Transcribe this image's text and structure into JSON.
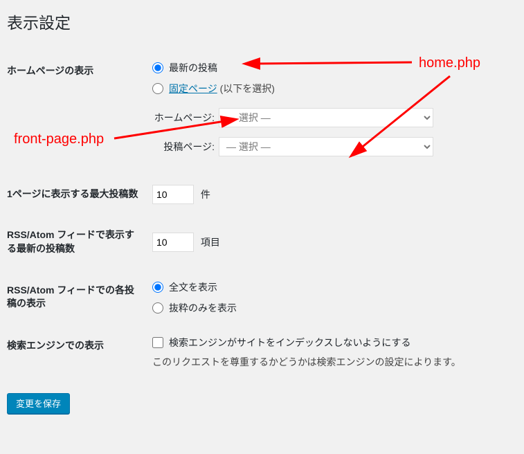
{
  "page_title": "表示設定",
  "homepage": {
    "label": "ホームページの表示",
    "opt_latest": "最新の投稿",
    "opt_static_link": "固定ページ",
    "opt_static_suffix": "(以下を選択)",
    "homepage_select_label": "ホームページ:",
    "posts_select_label": "投稿ページ:",
    "select_placeholder": "— 選択 —"
  },
  "posts_per_page": {
    "label": "1ページに表示する最大投稿数",
    "value": "10",
    "unit": "件"
  },
  "rss_posts": {
    "label": "RSS/Atom フィードで表示する最新の投稿数",
    "value": "10",
    "unit": "項目"
  },
  "rss_display": {
    "label": "RSS/Atom フィードでの各投稿の表示",
    "opt_full": "全文を表示",
    "opt_excerpt": "抜粋のみを表示"
  },
  "search_engine": {
    "label": "検索エンジンでの表示",
    "checkbox_label": "検索エンジンがサイトをインデックスしないようにする",
    "desc": "このリクエストを尊重するかどうかは検索エンジンの設定によります。"
  },
  "submit_label": "変更を保存",
  "annotations": {
    "home_php": "home.php",
    "front_page_php": "front-page.php"
  }
}
